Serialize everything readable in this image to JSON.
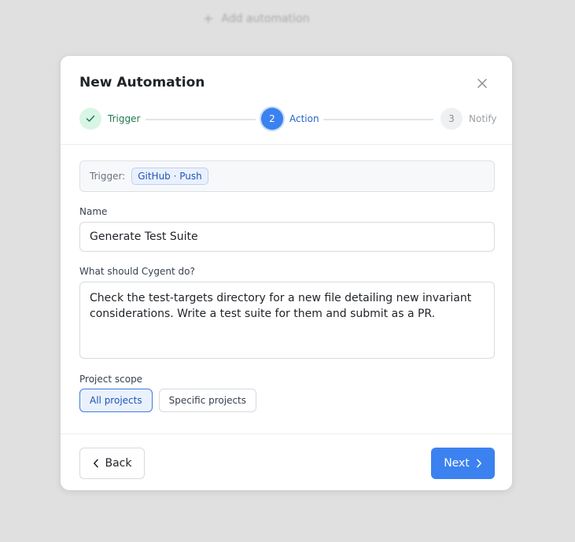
{
  "background": {
    "add_automation_label": "Add automation"
  },
  "modal": {
    "title": "New Automation",
    "close_icon": "close-icon"
  },
  "stepper": {
    "steps": [
      {
        "label": "Trigger",
        "number": "1",
        "state": "completed"
      },
      {
        "label": "Action",
        "number": "2",
        "state": "active"
      },
      {
        "label": "Notify",
        "number": "3",
        "state": "pending"
      }
    ]
  },
  "trigger": {
    "label": "Trigger:",
    "value": "GitHub · Push"
  },
  "name_field": {
    "label": "Name",
    "value": "Generate Test Suite"
  },
  "prompt_field": {
    "label": "What should Cygent do?",
    "value": "Check the test-targets directory for a new file detailing new invariant considerations. Write a test suite for them and submit as a PR."
  },
  "scope": {
    "label": "Project scope",
    "options": [
      {
        "label": "All projects",
        "selected": true
      },
      {
        "label": "Specific projects",
        "selected": false
      }
    ]
  },
  "footer": {
    "back_label": "Back",
    "next_label": "Next"
  },
  "colors": {
    "accent": "#3b82f0",
    "success": "#1f7a4d",
    "success_bg": "#d9f5e6",
    "overlay": "#dfe0df"
  }
}
